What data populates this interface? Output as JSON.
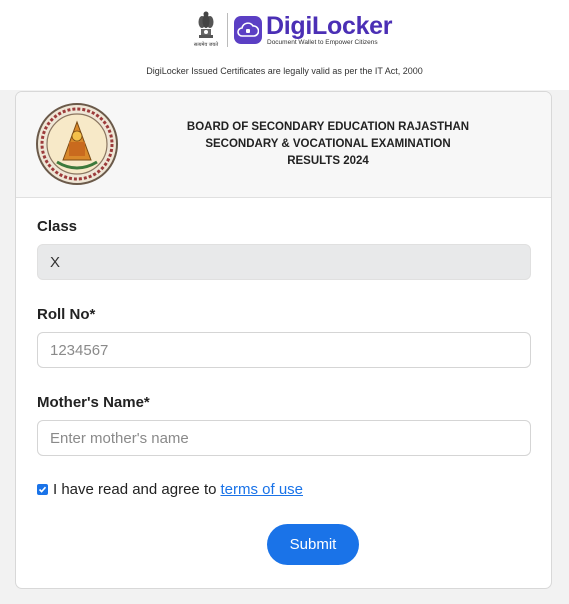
{
  "header": {
    "emblem_caption": "सत्यमेव जयते",
    "brand_name": "DigiLocker",
    "brand_tagline": "Document Wallet to Empower Citizens",
    "legal_notice": "DigiLocker Issued Certificates are legally valid as per the IT Act, 2000"
  },
  "board": {
    "line1": "BOARD OF SECONDARY EDUCATION RAJASTHAN",
    "line2": "SECONDARY & VOCATIONAL EXAMINATION",
    "line3": "RESULTS 2024"
  },
  "form": {
    "class_label": "Class",
    "class_value": "X",
    "roll_label": "Roll No*",
    "roll_placeholder": "1234567",
    "mother_label": "Mother's Name*",
    "mother_placeholder": "Enter mother's name",
    "agree_text": "I have read and agree to",
    "agree_checked": true,
    "terms_link": "terms of use",
    "submit_label": "Submit"
  },
  "colors": {
    "accent": "#1a73e8",
    "brand": "#4b2fb5"
  }
}
